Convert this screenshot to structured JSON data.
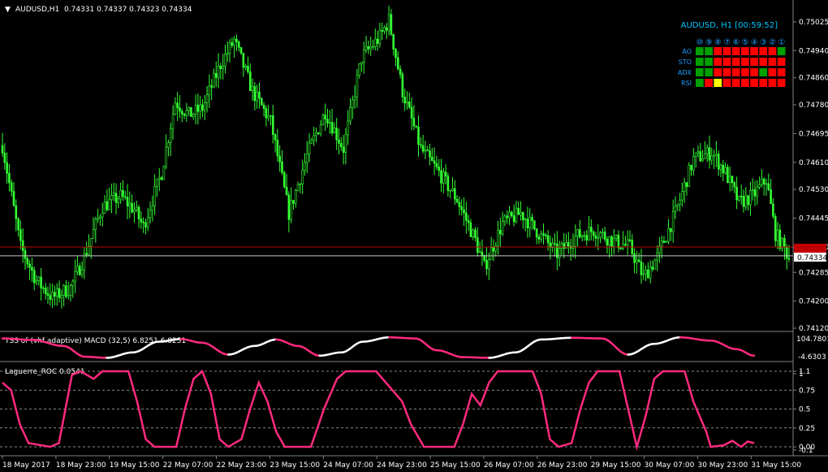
{
  "header": {
    "symbol": "AUDUSD,H1",
    "ohlc": "0.74331 0.74337 0.74323 0.74334"
  },
  "dashboard": {
    "title": "AUDUSD, H1 [00:59:52]",
    "columns": [
      "⑩",
      "⑨",
      "⑧",
      "⑦",
      "⑥",
      "⑤",
      "④",
      "③",
      "②",
      "①"
    ],
    "rows": [
      {
        "label": "AO",
        "cells": [
          "green",
          "green",
          "red",
          "red",
          "red",
          "red",
          "red",
          "red",
          "red",
          "green"
        ]
      },
      {
        "label": "STO",
        "cells": [
          "green",
          "green",
          "red",
          "red",
          "red",
          "red",
          "red",
          "red",
          "red",
          "red"
        ]
      },
      {
        "label": "ADX",
        "cells": [
          "green",
          "green",
          "red",
          "red",
          "red",
          "red",
          "red",
          "green",
          "red",
          "red"
        ]
      },
      {
        "label": "RSI",
        "cells": [
          "green",
          "red",
          "yellow",
          "red",
          "red",
          "red",
          "red",
          "red",
          "red",
          "red"
        ]
      }
    ]
  },
  "colors": {
    "background": "#000000",
    "candle": "#32ff32",
    "bid_line": "#c00000",
    "ask_line": "#c8c8c8",
    "tss_up": "#ffffff",
    "tss_down": "#ff2a7f",
    "laguerre": "#ff2a7f",
    "green_cell": "#00a000",
    "red_cell": "#ff0000",
    "yellow_cell": "#ffff00",
    "label_blue": "#1ea0ff"
  },
  "chart_data": [
    {
      "type": "candlestick",
      "title": "AUDUSD,H1",
      "ylim": [
        0.7412,
        0.7508
      ],
      "y_ticks": [
        "0.75025",
        "0.74940",
        "0.74860",
        "0.74780",
        "0.74695",
        "0.74610",
        "0.74530",
        "0.74445",
        "0.74360",
        "0.74285",
        "0.74200",
        "0.74120"
      ],
      "current_price_label": "0.74334",
      "bid_price": 0.7436,
      "ask_price": 0.74334,
      "x_ticks": [
        "18 May 2017",
        "18 May 23:00",
        "19 May 15:00",
        "22 May 07:00",
        "22 May 23:00",
        "23 May 15:00",
        "24 May 07:00",
        "24 May 23:00",
        "25 May 15:00",
        "26 May 07:00",
        "26 May 23:00",
        "29 May 15:00",
        "30 May 07:00",
        "30 May 23:00",
        "31 May 15:00"
      ],
      "close_path": [
        {
          "i": 0,
          "v": 0.7466
        },
        {
          "i": 8,
          "v": 0.7436
        },
        {
          "i": 15,
          "v": 0.7426
        },
        {
          "i": 22,
          "v": 0.7421
        },
        {
          "i": 30,
          "v": 0.7424
        },
        {
          "i": 36,
          "v": 0.7433
        },
        {
          "i": 44,
          "v": 0.7448
        },
        {
          "i": 52,
          "v": 0.7451
        },
        {
          "i": 58,
          "v": 0.7447
        },
        {
          "i": 62,
          "v": 0.7442
        },
        {
          "i": 70,
          "v": 0.7458
        },
        {
          "i": 76,
          "v": 0.7479
        },
        {
          "i": 82,
          "v": 0.7475
        },
        {
          "i": 88,
          "v": 0.7477
        },
        {
          "i": 96,
          "v": 0.749
        },
        {
          "i": 102,
          "v": 0.7497
        },
        {
          "i": 110,
          "v": 0.7482
        },
        {
          "i": 118,
          "v": 0.7473
        },
        {
          "i": 126,
          "v": 0.7446
        },
        {
          "i": 134,
          "v": 0.7463
        },
        {
          "i": 142,
          "v": 0.7476
        },
        {
          "i": 150,
          "v": 0.7465
        },
        {
          "i": 158,
          "v": 0.7492
        },
        {
          "i": 166,
          "v": 0.7498
        },
        {
          "i": 170,
          "v": 0.7503
        },
        {
          "i": 176,
          "v": 0.7482
        },
        {
          "i": 184,
          "v": 0.7465
        },
        {
          "i": 192,
          "v": 0.7458
        },
        {
          "i": 200,
          "v": 0.745
        },
        {
          "i": 208,
          "v": 0.7438
        },
        {
          "i": 212,
          "v": 0.743
        },
        {
          "i": 220,
          "v": 0.7443
        },
        {
          "i": 228,
          "v": 0.7446
        },
        {
          "i": 236,
          "v": 0.744
        },
        {
          "i": 244,
          "v": 0.7434
        },
        {
          "i": 252,
          "v": 0.7439
        },
        {
          "i": 260,
          "v": 0.7441
        },
        {
          "i": 268,
          "v": 0.7438
        },
        {
          "i": 276,
          "v": 0.7436
        },
        {
          "i": 282,
          "v": 0.7427
        },
        {
          "i": 288,
          "v": 0.7433
        },
        {
          "i": 296,
          "v": 0.7446
        },
        {
          "i": 304,
          "v": 0.7462
        },
        {
          "i": 312,
          "v": 0.7464
        },
        {
          "i": 318,
          "v": 0.7458
        },
        {
          "i": 324,
          "v": 0.7449
        },
        {
          "i": 330,
          "v": 0.7451
        },
        {
          "i": 336,
          "v": 0.7456
        },
        {
          "i": 340,
          "v": 0.744
        },
        {
          "i": 346,
          "v": 0.7433
        }
      ],
      "n_bars": 347
    },
    {
      "type": "line",
      "title": "TSS of (vhf adaptive) MACD (32,5) 6.8251 6.8251",
      "y_ticks": [
        "104.7801",
        "-4.6303"
      ],
      "ylim": [
        -4.6303,
        104.7801
      ],
      "x_range": [
        0,
        346
      ],
      "points": [
        {
          "x": 0,
          "v": 95
        },
        {
          "x": 14,
          "v": 88
        },
        {
          "x": 28,
          "v": 60
        },
        {
          "x": 38,
          "v": 10
        },
        {
          "x": 48,
          "v": 5
        },
        {
          "x": 60,
          "v": 30
        },
        {
          "x": 72,
          "v": 80
        },
        {
          "x": 82,
          "v": 92
        },
        {
          "x": 92,
          "v": 75
        },
        {
          "x": 104,
          "v": 20
        },
        {
          "x": 116,
          "v": 60
        },
        {
          "x": 126,
          "v": 90
        },
        {
          "x": 136,
          "v": 60
        },
        {
          "x": 146,
          "v": 15
        },
        {
          "x": 156,
          "v": 30
        },
        {
          "x": 166,
          "v": 80
        },
        {
          "x": 178,
          "v": 100
        },
        {
          "x": 190,
          "v": 95
        },
        {
          "x": 200,
          "v": 40
        },
        {
          "x": 212,
          "v": 8
        },
        {
          "x": 224,
          "v": 5
        },
        {
          "x": 236,
          "v": 30
        },
        {
          "x": 248,
          "v": 90
        },
        {
          "x": 262,
          "v": 98
        },
        {
          "x": 276,
          "v": 95
        },
        {
          "x": 288,
          "v": 20
        },
        {
          "x": 300,
          "v": 70
        },
        {
          "x": 312,
          "v": 100
        },
        {
          "x": 326,
          "v": 85
        },
        {
          "x": 338,
          "v": 45
        },
        {
          "x": 346,
          "v": 15
        }
      ]
    },
    {
      "type": "line",
      "title": "Laguerre_ROC 0.0541",
      "ylim": [
        0,
        1.1
      ],
      "y_ticks": [
        "1.1",
        "1",
        "0.75",
        "0.5",
        "0.25",
        "0.00",
        "-0.1"
      ],
      "x_range": [
        0,
        346
      ],
      "points": [
        {
          "x": 0,
          "v": 0.85
        },
        {
          "x": 4,
          "v": 0.75
        },
        {
          "x": 8,
          "v": 0.3
        },
        {
          "x": 12,
          "v": 0.05
        },
        {
          "x": 22,
          "v": 0.0
        },
        {
          "x": 26,
          "v": 0.05
        },
        {
          "x": 32,
          "v": 0.95
        },
        {
          "x": 36,
          "v": 1.0
        },
        {
          "x": 42,
          "v": 0.9
        },
        {
          "x": 46,
          "v": 1.0
        },
        {
          "x": 58,
          "v": 1.0
        },
        {
          "x": 62,
          "v": 0.6
        },
        {
          "x": 66,
          "v": 0.1
        },
        {
          "x": 70,
          "v": 0.0
        },
        {
          "x": 80,
          "v": 0.0
        },
        {
          "x": 84,
          "v": 0.5
        },
        {
          "x": 88,
          "v": 0.9
        },
        {
          "x": 92,
          "v": 1.0
        },
        {
          "x": 96,
          "v": 0.7
        },
        {
          "x": 100,
          "v": 0.1
        },
        {
          "x": 104,
          "v": 0.0
        },
        {
          "x": 110,
          "v": 0.1
        },
        {
          "x": 114,
          "v": 0.5
        },
        {
          "x": 118,
          "v": 0.85
        },
        {
          "x": 122,
          "v": 0.6
        },
        {
          "x": 126,
          "v": 0.2
        },
        {
          "x": 130,
          "v": 0.0
        },
        {
          "x": 142,
          "v": 0.0
        },
        {
          "x": 148,
          "v": 0.5
        },
        {
          "x": 154,
          "v": 0.9
        },
        {
          "x": 158,
          "v": 1.0
        },
        {
          "x": 172,
          "v": 1.0
        },
        {
          "x": 178,
          "v": 0.8
        },
        {
          "x": 184,
          "v": 0.6
        },
        {
          "x": 188,
          "v": 0.3
        },
        {
          "x": 194,
          "v": 0.0
        },
        {
          "x": 208,
          "v": 0.0
        },
        {
          "x": 212,
          "v": 0.3
        },
        {
          "x": 216,
          "v": 0.7
        },
        {
          "x": 220,
          "v": 0.55
        },
        {
          "x": 224,
          "v": 0.85
        },
        {
          "x": 228,
          "v": 1.0
        },
        {
          "x": 244,
          "v": 1.0
        },
        {
          "x": 248,
          "v": 0.7
        },
        {
          "x": 252,
          "v": 0.1
        },
        {
          "x": 256,
          "v": 0.0
        },
        {
          "x": 262,
          "v": 0.05
        },
        {
          "x": 266,
          "v": 0.5
        },
        {
          "x": 270,
          "v": 0.85
        },
        {
          "x": 274,
          "v": 1.0
        },
        {
          "x": 284,
          "v": 1.0
        },
        {
          "x": 288,
          "v": 0.5
        },
        {
          "x": 292,
          "v": 0.0
        },
        {
          "x": 296,
          "v": 0.4
        },
        {
          "x": 300,
          "v": 0.9
        },
        {
          "x": 304,
          "v": 1.0
        },
        {
          "x": 314,
          "v": 1.0
        },
        {
          "x": 318,
          "v": 0.6
        },
        {
          "x": 324,
          "v": 0.2
        },
        {
          "x": 326,
          "v": 0.0
        },
        {
          "x": 332,
          "v": 0.02
        },
        {
          "x": 336,
          "v": 0.08
        },
        {
          "x": 340,
          "v": 0.0
        },
        {
          "x": 343,
          "v": 0.07
        },
        {
          "x": 346,
          "v": 0.05
        }
      ]
    }
  ]
}
